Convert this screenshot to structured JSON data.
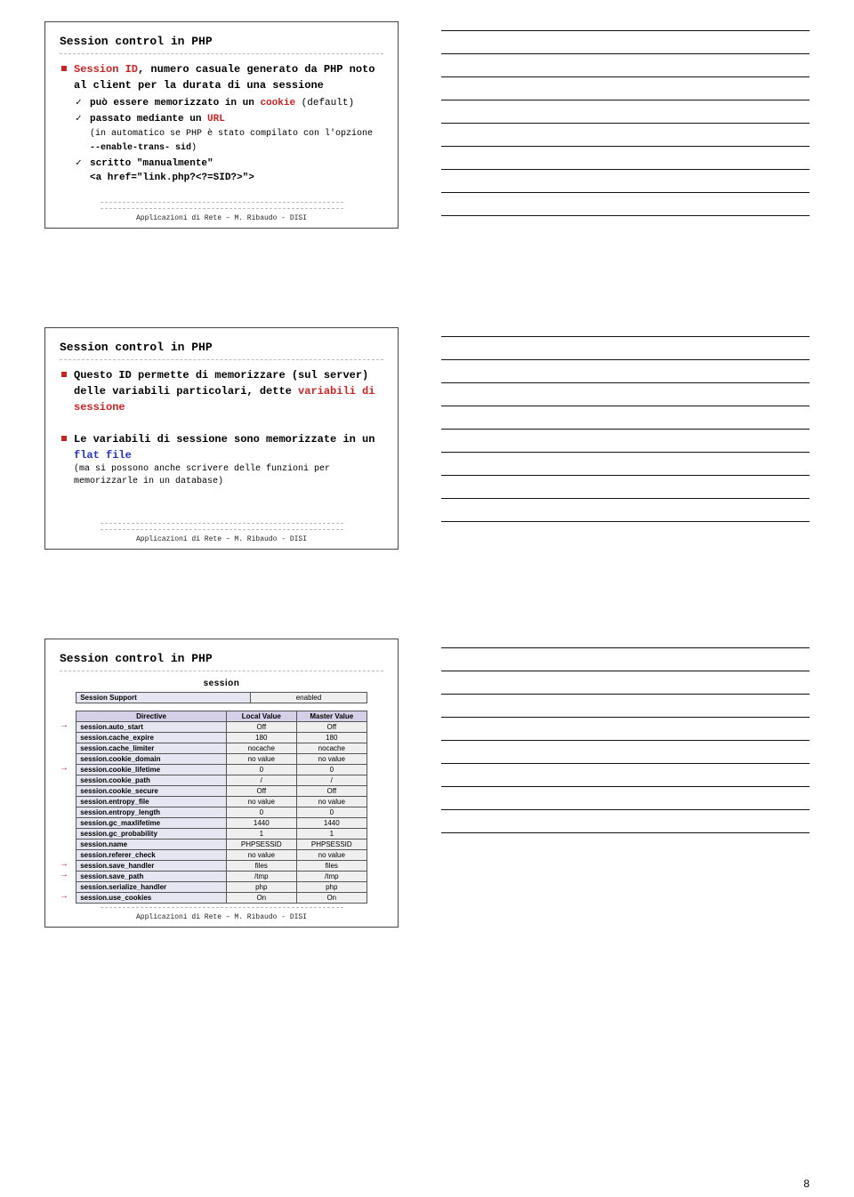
{
  "page_number": "8",
  "footer_text": "Applicazioni di Rete – M. Ribaudo - DISI",
  "slide1": {
    "title": "Session control in PHP",
    "lead_a": "Session ID",
    "lead_b": ", numero casuale generato da PHP noto al client per la durata di una sessione",
    "sub1_a": "può essere memorizzato in un ",
    "sub1_b": "cookie",
    "sub1_c": " (default)",
    "sub2_a": "passato mediante un ",
    "sub2_b": "URL",
    "sub2_c": "(in automatico se PHP è stato compilato con l'opzione ",
    "sub2_d": "--enable-trans- sid",
    "sub2_e": ")",
    "sub3_a": "scritto \"manualmente\"",
    "sub3_b": "<a href=\"link.php?<?=SID?>\">"
  },
  "slide2": {
    "title": "Session control in PHP",
    "b1_a": "Questo ID permette di memorizzare (sul server) delle variabili particolari, dette ",
    "b1_b": "variabili di sessione",
    "b2_a": "Le variabili di sessione sono memorizzate in un ",
    "b2_b": "flat file",
    "b2_sub": "(ma si possono anche scrivere delle funzioni per memorizzarle in un database)"
  },
  "slide3": {
    "title": "Session control in PHP",
    "section_title": "session",
    "support_tbl": {
      "label": "Session Support",
      "value": "enabled"
    },
    "headers": {
      "c1": "Directive",
      "c2": "Local Value",
      "c3": "Master Value"
    },
    "rows": [
      {
        "k": "session.auto_start",
        "v1": "Off",
        "v2": "Off",
        "arrow": true
      },
      {
        "k": "session.cache_expire",
        "v1": "180",
        "v2": "180",
        "arrow": false
      },
      {
        "k": "session.cache_limiter",
        "v1": "nocache",
        "v2": "nocache",
        "arrow": false
      },
      {
        "k": "session.cookie_domain",
        "v1": "no value",
        "v2": "no value",
        "arrow": false
      },
      {
        "k": "session.cookie_lifetime",
        "v1": "0",
        "v2": "0",
        "arrow": true
      },
      {
        "k": "session.cookie_path",
        "v1": "/",
        "v2": "/",
        "arrow": false
      },
      {
        "k": "session.cookie_secure",
        "v1": "Off",
        "v2": "Off",
        "arrow": false
      },
      {
        "k": "session.entropy_file",
        "v1": "no value",
        "v2": "no value",
        "arrow": false
      },
      {
        "k": "session.entropy_length",
        "v1": "0",
        "v2": "0",
        "arrow": false
      },
      {
        "k": "session.gc_maxlifetime",
        "v1": "1440",
        "v2": "1440",
        "arrow": false
      },
      {
        "k": "session.gc_probability",
        "v1": "1",
        "v2": "1",
        "arrow": false
      },
      {
        "k": "session.name",
        "v1": "PHPSESSID",
        "v2": "PHPSESSID",
        "arrow": false
      },
      {
        "k": "session.referer_check",
        "v1": "no value",
        "v2": "no value",
        "arrow": false
      },
      {
        "k": "session.save_handler",
        "v1": "files",
        "v2": "files",
        "arrow": true
      },
      {
        "k": "session.save_path",
        "v1": "/tmp",
        "v2": "/tmp",
        "arrow": true
      },
      {
        "k": "session.serialize_handler",
        "v1": "php",
        "v2": "php",
        "arrow": false
      },
      {
        "k": "session.use_cookies",
        "v1": "On",
        "v2": "On",
        "arrow": true
      }
    ]
  }
}
